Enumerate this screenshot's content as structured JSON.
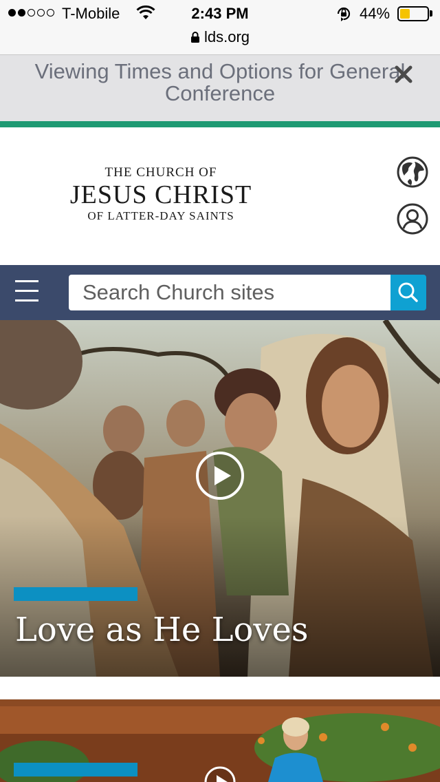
{
  "status_bar": {
    "carrier": "T-Mobile",
    "signal_bars": 2,
    "signal_total": 5,
    "time": "2:43 PM",
    "battery_percent_text": "44%",
    "battery_level": 0.44,
    "url": "lds.org",
    "icons": [
      "wifi-icon",
      "rotation-lock-icon",
      "battery-icon",
      "lock-icon"
    ]
  },
  "banner": {
    "text": "Viewing Times and Options for General Conference",
    "close_icon": "close-icon"
  },
  "header": {
    "logo": {
      "line1": "THE CHURCH OF",
      "line2": "JESUS CHRIST",
      "line3": "OF LATTER-DAY SAINTS"
    },
    "icons": [
      "globe-icon",
      "user-icon"
    ]
  },
  "nav": {
    "menu_icon": "hamburger-menu-icon",
    "search_placeholder": "Search Church sites",
    "search_icon": "search-icon"
  },
  "hero": {
    "title": "Love as He Loves",
    "play_icon": "play-icon"
  },
  "card2": {
    "play_icon": "play-icon"
  },
  "colors": {
    "status_bg": "#f7f7f7",
    "banner_bg": "#e3e3e5",
    "banner_text": "#6b6f7b",
    "accent_green": "#1f9a73",
    "nav_bg": "#3b4a6b",
    "search_button": "#0fa1d2",
    "title_accent": "#0c90c2",
    "battery_fill": "#f5c300"
  }
}
